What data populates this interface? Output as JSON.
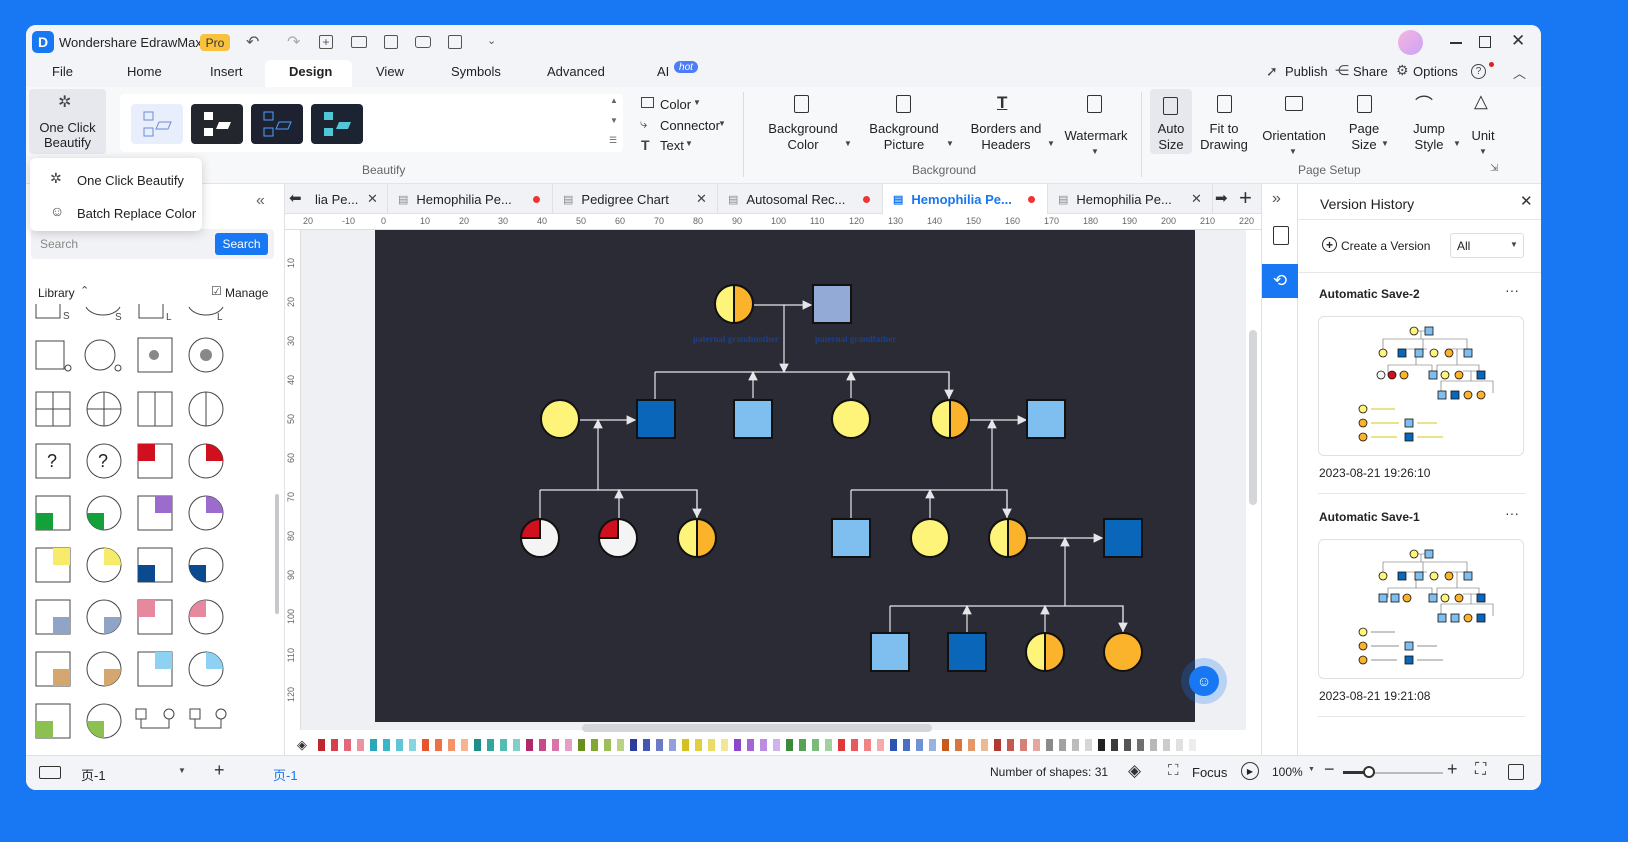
{
  "app": {
    "name": "Wondershare EdrawMax",
    "badge": "Pro"
  },
  "menu": [
    "File",
    "Home",
    "Insert",
    "Design",
    "View",
    "Symbols",
    "Advanced",
    "AI"
  ],
  "menu_ai_badge": "hot",
  "top_right": {
    "publish": "Publish",
    "share": "Share",
    "options": "Options"
  },
  "ribbon": {
    "one_click_beautify": "One Click\nBeautify",
    "beautify_group": "Beautify",
    "color": "Color",
    "connector": "Connector",
    "text": "Text",
    "background_color": "Background\nColor",
    "background_picture": "Background\nPicture",
    "borders_headers": "Borders and\nHeaders",
    "watermark": "Watermark",
    "background_group": "Background",
    "auto_size": "Auto\nSize",
    "fit_to_drawing": "Fit to\nDrawing",
    "orientation": "Orientation",
    "page_size": "Page\nSize",
    "jump_style": "Jump\nStyle",
    "unit": "Unit",
    "page_setup_group": "Page Setup"
  },
  "dropdown": {
    "item1": "One Click Beautify",
    "item2": "Batch Replace Color"
  },
  "left": {
    "search_placeholder": "Search",
    "search_button": "Search",
    "library": "Library",
    "manage": "Manage"
  },
  "tabs": [
    {
      "label": "lia Pe...",
      "state": "close"
    },
    {
      "label": "Hemophilia Pe...",
      "state": "dot"
    },
    {
      "label": "Pedigree Chart",
      "state": "close"
    },
    {
      "label": "Autosomal Rec...",
      "state": "dot"
    },
    {
      "label": "Hemophilia Pe...",
      "state": "dot",
      "active": true
    },
    {
      "label": "Hemophilia Pe...",
      "state": "close"
    }
  ],
  "ruler_h": [
    "20",
    "-10",
    "0",
    "10",
    "20",
    "30",
    "40",
    "50",
    "60",
    "70",
    "80",
    "90",
    "100",
    "110",
    "120",
    "130",
    "140",
    "150",
    "160",
    "170",
    "180",
    "190",
    "200",
    "210",
    "220"
  ],
  "ruler_v": [
    "10",
    "20",
    "30",
    "40",
    "50",
    "60",
    "70",
    "80",
    "90",
    "100",
    "110",
    "120"
  ],
  "diagram": {
    "label1": "paternal grandmother",
    "label2": "paternal grandfather"
  },
  "version_history": {
    "title": "Version History",
    "create": "Create a Version",
    "filter": "All",
    "entries": [
      {
        "name": "Automatic Save-2",
        "time": "2023-08-21 19:26:10"
      },
      {
        "name": "Automatic Save-1",
        "time": "2023-08-21 19:21:08"
      }
    ]
  },
  "status": {
    "page": "页-1",
    "page_tab": "页-1",
    "shapes": "Number of shapes: 31",
    "focus": "Focus",
    "zoom": "100%"
  },
  "colors": {
    "accent": "#1877f2",
    "canvas": "#2b2b35",
    "yellow": "#fff47a",
    "orange": "#fbb32c",
    "lightblue": "#7fbfef",
    "darkblue": "#0a66b8",
    "red": "#d0101e",
    "grandfather": "#93a9d6"
  }
}
